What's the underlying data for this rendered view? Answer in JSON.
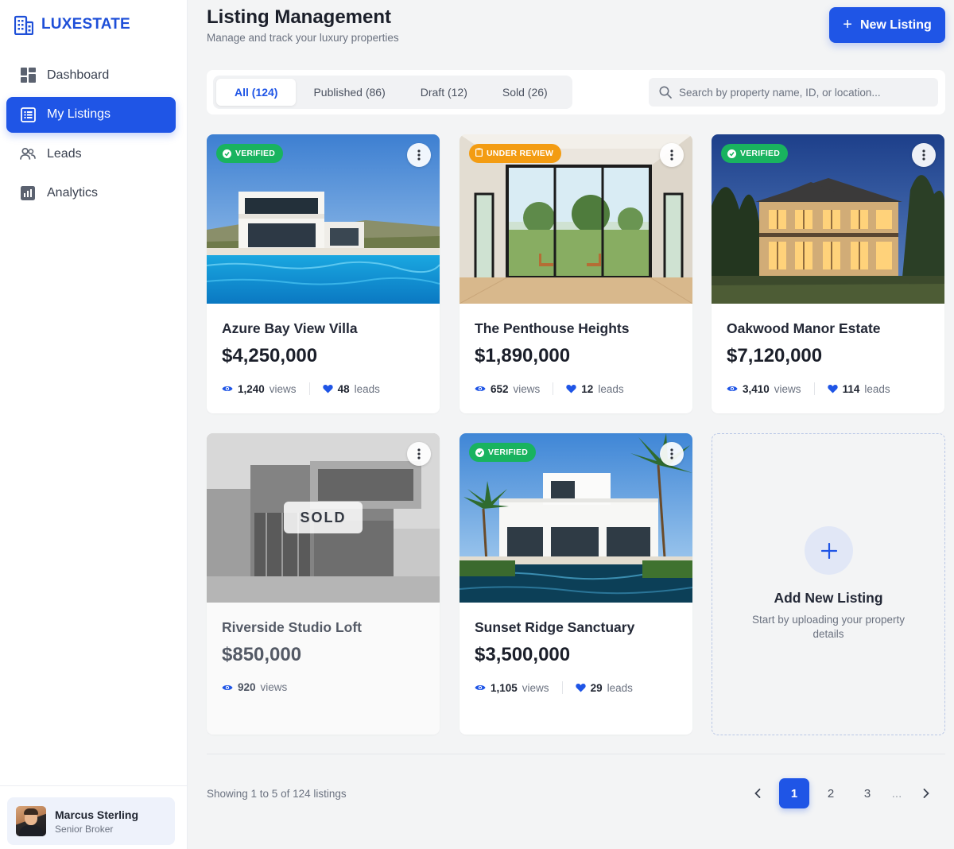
{
  "brand": {
    "name": "LUXESTATE",
    "icon": "building-icon"
  },
  "sidebar": {
    "items": [
      {
        "label": "Dashboard",
        "icon": "dashboard-icon",
        "active": false
      },
      {
        "label": "My Listings",
        "icon": "listings-icon",
        "active": true
      },
      {
        "label": "Leads",
        "icon": "users-icon",
        "active": false
      },
      {
        "label": "Analytics",
        "icon": "analytics-icon",
        "active": false
      }
    ],
    "profile": {
      "name": "Marcus Sterling",
      "role": "Senior Broker"
    }
  },
  "header": {
    "title": "Listing Management",
    "subtitle": "Manage and track your luxury properties",
    "new_button": "New Listing"
  },
  "filters": {
    "tabs": [
      {
        "label": "All (124)",
        "active": true
      },
      {
        "label": "Published (86)",
        "active": false
      },
      {
        "label": "Draft (12)",
        "active": false
      },
      {
        "label": "Sold (26)",
        "active": false
      }
    ],
    "search_placeholder": "Search by property name, ID, or location..."
  },
  "listings": [
    {
      "name": "Azure Bay View Villa",
      "price": "$4,250,000",
      "views": "1,240",
      "views_label": "views",
      "leads": "48",
      "leads_label": "leads",
      "badge": "VERIFIED"
    },
    {
      "name": "The Penthouse Heights",
      "price": "$1,890,000",
      "views": "652",
      "views_label": "views",
      "leads": "12",
      "leads_label": "leads",
      "badge": "UNDER REVIEW"
    },
    {
      "name": "Oakwood Manor Estate",
      "price": "$7,120,000",
      "views": "3,410",
      "views_label": "views",
      "leads": "114",
      "leads_label": "leads",
      "badge": "VERIFIED"
    },
    {
      "name": "Riverside Studio Loft",
      "price": "$850,000",
      "views": "920",
      "views_label": "views",
      "overlay": "SOLD"
    },
    {
      "name": "Sunset Ridge Sanctuary",
      "price": "$3,500,000",
      "views": "1,105",
      "views_label": "views",
      "leads": "29",
      "leads_label": "leads",
      "badge": "VERIFIED"
    }
  ],
  "add_card": {
    "title": "Add New Listing",
    "subtitle": "Start by uploading your property details"
  },
  "footer": {
    "showing": "Showing 1 to 5 of 124 listings",
    "pages": [
      "1",
      "2",
      "3",
      "..."
    ],
    "current_page": "1"
  },
  "colors": {
    "accent": "#1f55e6",
    "verified": "#19b35f",
    "review": "#f39c12"
  }
}
